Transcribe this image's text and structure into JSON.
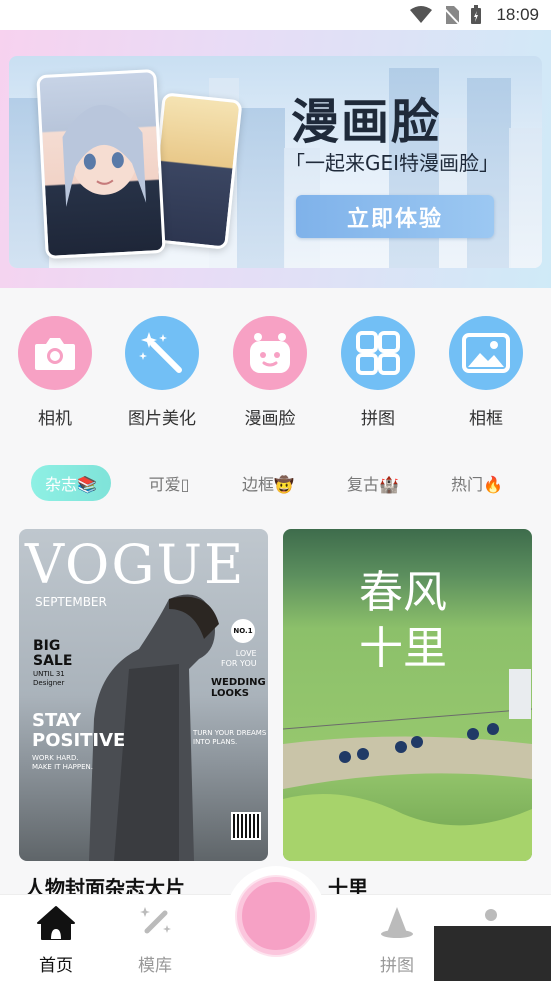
{
  "status_bar": {
    "time": "18:09"
  },
  "banner": {
    "title": "漫画脸",
    "subtitle": "「一起来GEI特漫画脸」",
    "button": "立即体验"
  },
  "grid": [
    {
      "label": "相机",
      "icon": "camera-icon",
      "color": "#f7a1c4"
    },
    {
      "label": "图片美化",
      "icon": "magic-wand-icon",
      "color": "#72bff5"
    },
    {
      "label": "漫画脸",
      "icon": "robot-face-icon",
      "color": "#f7a1c4"
    },
    {
      "label": "拼图",
      "icon": "collage-icon",
      "color": "#72bff5"
    },
    {
      "label": "相框",
      "icon": "photo-frame-icon",
      "color": "#72bff5"
    }
  ],
  "tabs": [
    {
      "label": "杂志📚",
      "active": true
    },
    {
      "label": "可爱▯",
      "active": false
    },
    {
      "label": "边框🤠",
      "active": false
    },
    {
      "label": "复古🏰",
      "active": false
    },
    {
      "label": "热门🔥",
      "active": false
    }
  ],
  "cards": [
    {
      "title": "人物封面杂志大片",
      "vogue": "VOGUE",
      "month": "SEPTEMBER",
      "big_sale": "BIG\nSALE",
      "until": "UNTIL 31",
      "designer": "Designer",
      "stay_positive": "STAY\nPOSITIVE",
      "work_hard": "WORK HARD.\nMAKE IT HAPPEN.",
      "no1": "NO.1",
      "love": "LOVE\nFOR YOU",
      "wedding": "WEDDING\nLOOKS",
      "dreams": "TURN YOUR DREAMS\nINTO PLANS."
    },
    {
      "title": "十里",
      "calligraphy": "春风十里"
    }
  ],
  "nav": [
    {
      "label": "首页",
      "icon": "home-icon",
      "active": true
    },
    {
      "label": "模库",
      "icon": "magic-wand-icon",
      "active": false
    },
    {
      "label": "拼图",
      "icon": "wizard-hat-icon",
      "active": false
    }
  ],
  "colors": {
    "pink": "#f7a1c4",
    "blue": "#72bff5",
    "teal": "#7fe3d9"
  }
}
